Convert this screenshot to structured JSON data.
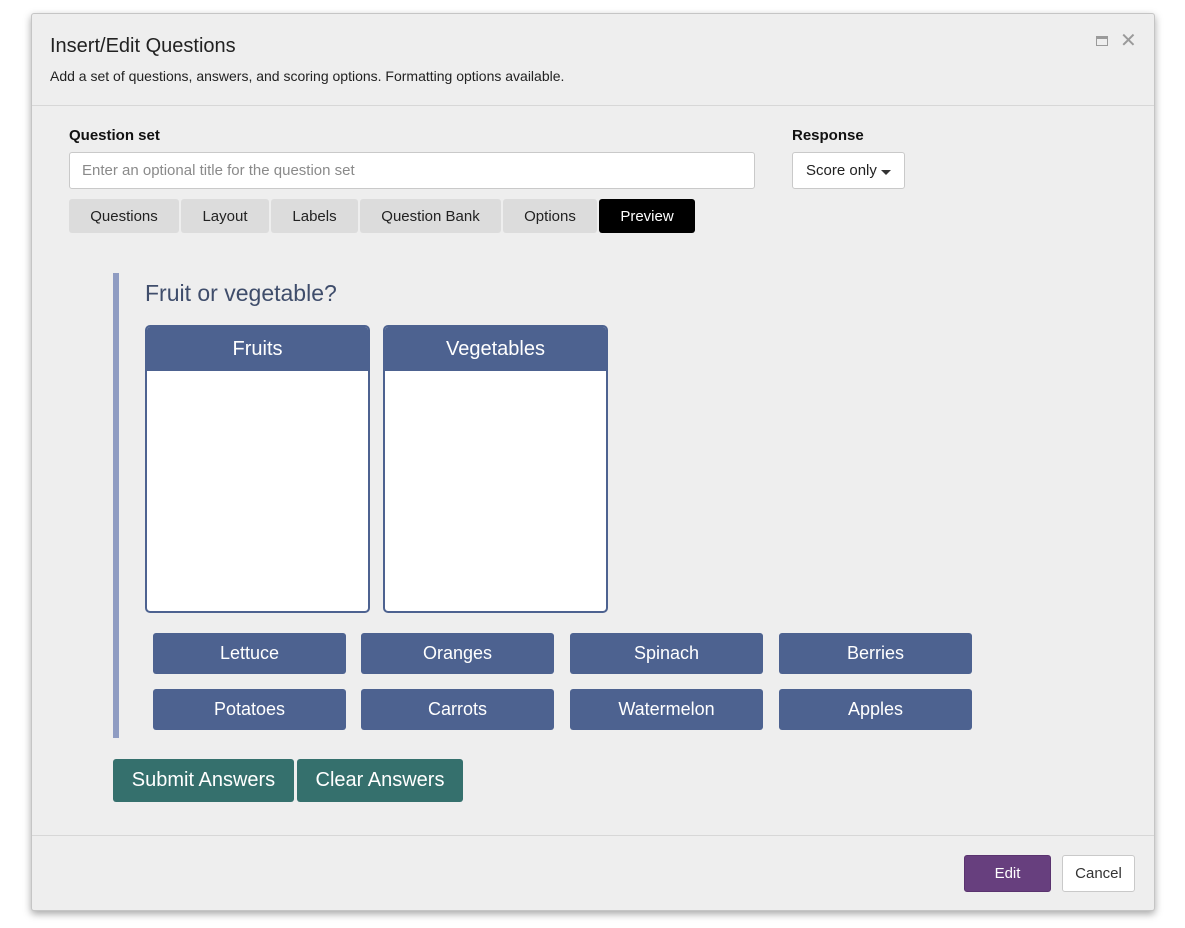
{
  "dialog": {
    "title": "Insert/Edit Questions",
    "subtitle": "Add a set of questions, answers, and scoring options. Formatting options available.",
    "maximize_icon": "maximize-icon",
    "close_glyph": "✕"
  },
  "question_set": {
    "label": "Question set",
    "value": "",
    "placeholder": "Enter an optional title for the question set"
  },
  "response": {
    "label": "Response",
    "selected": "Score only"
  },
  "tabs": [
    {
      "label": "Questions",
      "active": false
    },
    {
      "label": "Layout",
      "active": false
    },
    {
      "label": "Labels",
      "active": false
    },
    {
      "label": "Question Bank",
      "active": false
    },
    {
      "label": "Options",
      "active": false
    },
    {
      "label": "Preview",
      "active": true
    }
  ],
  "preview": {
    "question_title": "Fruit or vegetable?",
    "buckets": [
      {
        "label": "Fruits"
      },
      {
        "label": "Vegetables"
      }
    ],
    "items": [
      {
        "label": "Lettuce"
      },
      {
        "label": "Oranges"
      },
      {
        "label": "Spinach"
      },
      {
        "label": "Berries"
      },
      {
        "label": "Potatoes"
      },
      {
        "label": "Carrots"
      },
      {
        "label": "Watermelon"
      },
      {
        "label": "Apples"
      }
    ],
    "submit_label": "Submit Answers",
    "clear_label": "Clear Answers"
  },
  "footer": {
    "edit_label": "Edit",
    "cancel_label": "Cancel"
  },
  "colors": {
    "dialog_bg": "#eeeeee",
    "chip": "#4d6290",
    "action": "#35706d",
    "edit": "#673f7e",
    "active_tab": "#000000",
    "preview_border": "#8f9cc2"
  }
}
